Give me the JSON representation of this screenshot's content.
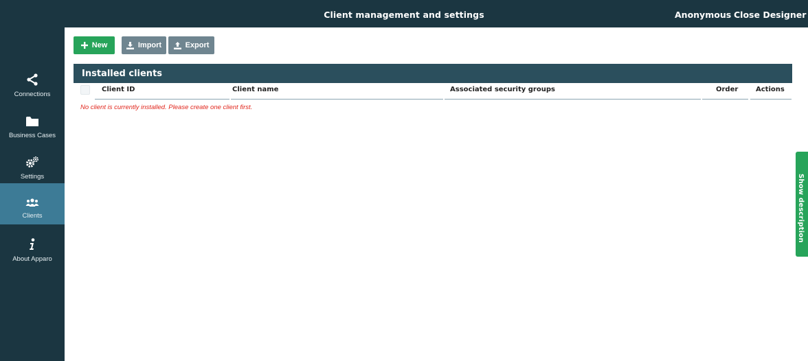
{
  "header": {
    "title": "Client management and settings",
    "user": "Anonymous",
    "close_label": "Close Designer"
  },
  "sidebar": {
    "items": [
      {
        "label": "Connections",
        "icon": "share-icon"
      },
      {
        "label": "Business Cases",
        "icon": "folder-icon"
      },
      {
        "label": "Settings",
        "icon": "gears-icon"
      },
      {
        "label": "Clients",
        "icon": "users-icon",
        "active": true
      },
      {
        "label": "About Apparo",
        "icon": "info-icon"
      }
    ]
  },
  "toolbar": {
    "new_label": "New",
    "import_label": "Import",
    "export_label": "Export"
  },
  "table": {
    "title": "Installed clients",
    "columns": [
      "Client ID",
      "Client name",
      "Associated security groups",
      "Order",
      "Actions"
    ],
    "rows": [],
    "empty_message": "No client is currently installed. Please create one client first."
  },
  "side_tab": {
    "label": "Show description"
  },
  "colors": {
    "header_bg": "#1b3641",
    "active_nav": "#3d7b96",
    "primary_green": "#27a45a",
    "secondary_grey": "#6f8590",
    "panel_head": "#2b4f5d",
    "error_text": "#e1251b"
  }
}
